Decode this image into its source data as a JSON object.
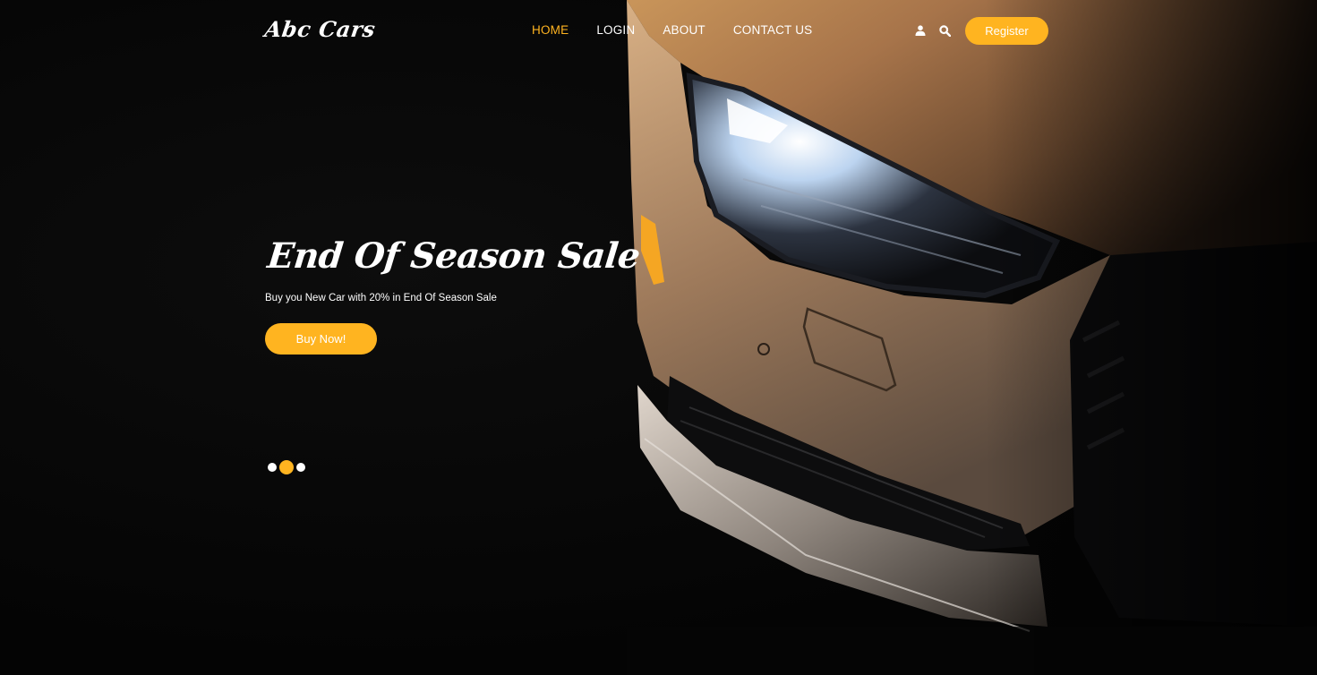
{
  "colors": {
    "accent": "#ffb420",
    "background": "#050505",
    "text": "#ffffff"
  },
  "header": {
    "logo": "Abc Cars",
    "nav": [
      {
        "label": "HOME",
        "active": true
      },
      {
        "label": "LOGIN",
        "active": false
      },
      {
        "label": "ABOUT",
        "active": false
      },
      {
        "label": "CONTACT US",
        "active": false
      }
    ],
    "icons": [
      "user-icon",
      "search-icon"
    ],
    "register_label": "Register"
  },
  "hero": {
    "title": "End Of Season Sale",
    "subtitle": "Buy you New Car with 20% in End Of Season Sale",
    "cta_label": "Buy Now!",
    "image": "car-headlight-photo"
  },
  "carousel": {
    "slides": 3,
    "active_index": 1
  }
}
